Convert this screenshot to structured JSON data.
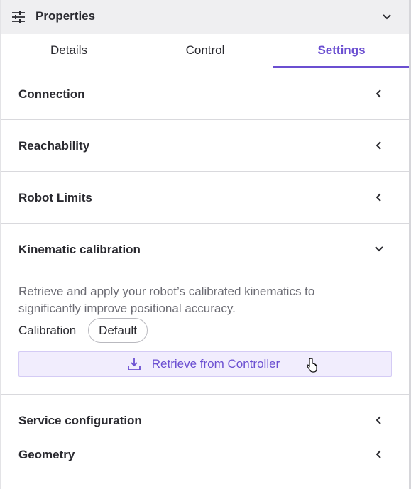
{
  "header": {
    "title": "Properties",
    "icon": "sliders-icon",
    "collapse_icon": "chevron-down-icon"
  },
  "tabs": [
    {
      "label": "Details",
      "active": false
    },
    {
      "label": "Control",
      "active": false
    },
    {
      "label": "Settings",
      "active": true
    }
  ],
  "sections": {
    "connection": {
      "title": "Connection",
      "expanded": false
    },
    "reachability": {
      "title": "Reachability",
      "expanded": false
    },
    "robot_limits": {
      "title": "Robot Limits",
      "expanded": false
    },
    "kinematic": {
      "title": "Kinematic calibration",
      "expanded": true,
      "description": "Retrieve and apply your robot’s calibrated kinematics to significantly improve positional accuracy.",
      "calibration_label": "Calibration",
      "calibration_value": "Default",
      "retrieve_button": "Retrieve from Controller"
    },
    "service": {
      "title": "Service configuration",
      "expanded": false
    },
    "geometry": {
      "title": "Geometry",
      "expanded": false
    }
  },
  "colors": {
    "accent": "#6b4fd1",
    "header_bg": "#efeff1",
    "button_bg": "#f1edfd",
    "divider": "#d9d9dd"
  }
}
